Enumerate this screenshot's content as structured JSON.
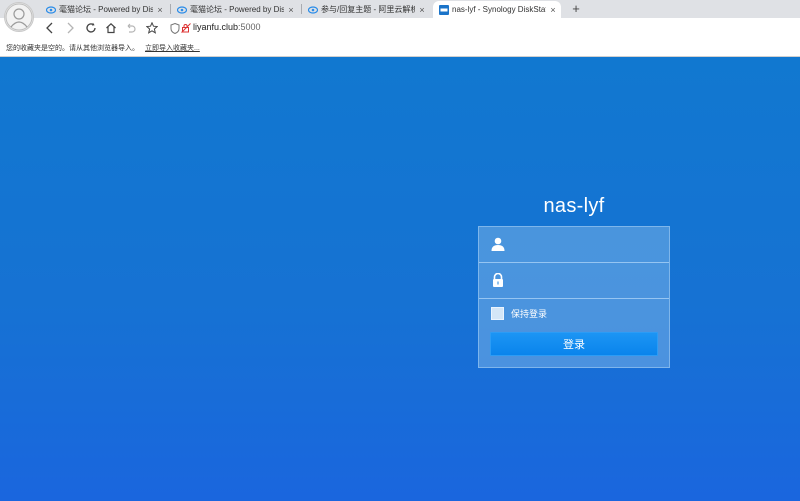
{
  "browser": {
    "tabs": [
      {
        "title": "毫猫论坛 - Powered by Discuz!",
        "icon": "eye-icon",
        "active": false
      },
      {
        "title": "毫猫论坛 - Powered by Discuz!",
        "icon": "eye-icon",
        "active": false
      },
      {
        "title": "参与/回复主题 - 阿里云解析问题",
        "icon": "eye-icon",
        "active": false
      },
      {
        "title": "nas-lyf - Synology DiskStation",
        "icon": "dsm-icon",
        "active": true
      }
    ],
    "close_glyph": "×",
    "new_tab_glyph": "+",
    "url": {
      "host": "liyanfu.club",
      "port": ":5000"
    },
    "bookmark_bar": {
      "message": "您的收藏夹是空的。请从其他浏览器导入。",
      "import_link": "立即导入收藏夹..."
    }
  },
  "login": {
    "hostname": "nas-lyf",
    "username_placeholder": "",
    "password_placeholder": "",
    "remember_label": "保持登录",
    "remember_checked": false,
    "submit_label": "登录"
  },
  "colors": {
    "page_background": "#1474d4",
    "login_button": "#0a84ec",
    "tab_icon_blue": "#2a8ce8",
    "insecure_red": "#d33"
  }
}
